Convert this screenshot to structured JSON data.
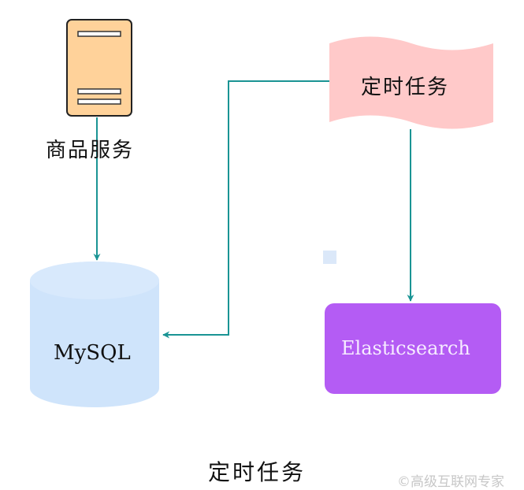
{
  "nodes": {
    "server": {
      "label": "商品服务"
    },
    "mysql": {
      "label": "MySQL"
    },
    "cron": {
      "label": "定时任务"
    },
    "elasticsearch": {
      "label": "Elasticsearch"
    }
  },
  "caption": "定时任务",
  "watermark": "©高级互联网专家",
  "colors": {
    "edge": "#1a9494",
    "server_fill": "#ffd29a",
    "server_stroke": "#222222",
    "mysql_fill": "#cfe4fb",
    "cron_fill": "#ffc9c9",
    "es_fill": "#b45cf4",
    "marker_fill": "#dbe8f9"
  }
}
